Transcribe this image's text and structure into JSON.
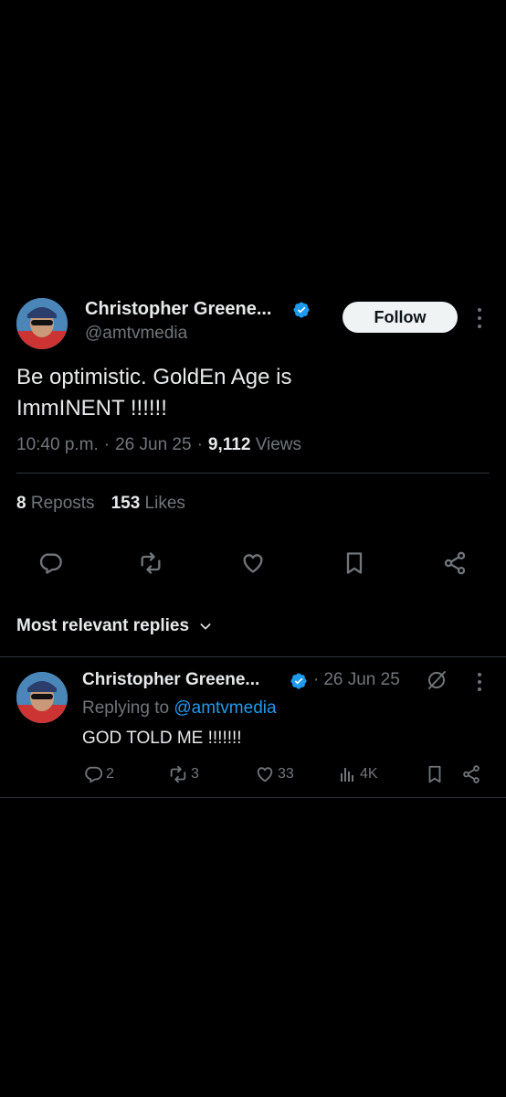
{
  "post": {
    "author_name": "Christopher Greene...",
    "handle": "@amtvmedia",
    "follow_label": "Follow",
    "text_line1": "Be optimistic. GoldEn Age is",
    "text_line2": "ImmINENT !!!!!!",
    "time": "10:40 p.m.",
    "sep1": "·",
    "date": "26 Jun 25",
    "sep2": "·",
    "views_count": "9,112",
    "views_label": "Views",
    "reposts_count": "8",
    "reposts_label": "Reposts",
    "likes_count": "153",
    "likes_label": "Likes"
  },
  "replies_section": {
    "title": "Most relevant replies"
  },
  "reply": {
    "author_name": "Christopher Greene...",
    "sep": "·",
    "date": "26 Jun 25",
    "replying_prefix": "Replying to",
    "replying_handle": "@amtvmedia",
    "text": "GOD TOLD ME !!!!!!!",
    "reply_count": "2",
    "repost_count": "3",
    "like_count": "33",
    "view_count": "4K"
  },
  "colors": {
    "background": "#000000",
    "text": "#e7e9ea",
    "muted": "#71767b",
    "accent": "#1d9bf0",
    "divider": "#2f3336"
  },
  "icons": [
    "verified-badge-icon",
    "more-icon",
    "reply-icon",
    "repost-icon",
    "like-icon",
    "bookmark-icon",
    "share-icon",
    "chevron-down-icon",
    "grok-icon",
    "views-icon"
  ]
}
